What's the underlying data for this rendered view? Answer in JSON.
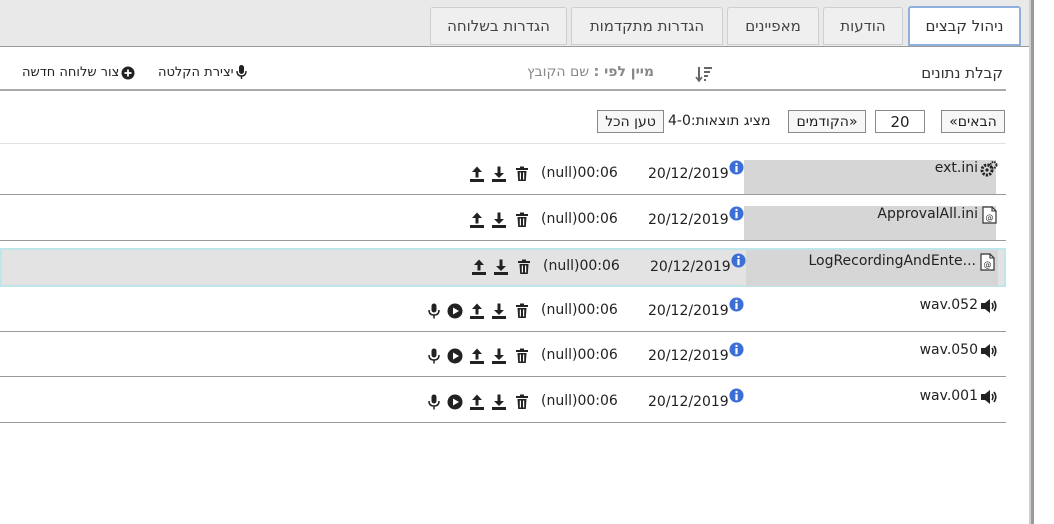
{
  "tabs": [
    {
      "label": "ניהול קבצים",
      "active": true
    },
    {
      "label": "הודעות",
      "active": false
    },
    {
      "label": "מאפיינים",
      "active": false
    },
    {
      "label": "הגדרות מתקדמות",
      "active": false
    },
    {
      "label": "הגדרות בשלוחה",
      "active": false
    }
  ],
  "toolbar": {
    "title": "קבלת נתונים",
    "sort_prefix": "מיין לפי :",
    "sort_value": " שם הקובץ",
    "record_label": "יצירת הקלטה",
    "new_ext_label": "צור שלוחה חדשה"
  },
  "pagination": {
    "next_label": "«הבאים",
    "page_size": "20",
    "prev_label": "הקודמים»",
    "showing_text": "מציג תוצאות:4-0",
    "load_all_label": "טען הכל"
  },
  "files": [
    {
      "name": "ext.ini",
      "icon": "gears-icon",
      "date": "20/12/2019",
      "duration": "(null)00:06",
      "audio": false,
      "highlighted": true,
      "selected": false
    },
    {
      "name": "ApprovalAll.ini",
      "icon": "ini-file-icon",
      "date": "20/12/2019",
      "duration": "(null)00:06",
      "audio": false,
      "highlighted": true,
      "selected": false
    },
    {
      "name": "LogRecordingAndEnte...",
      "icon": "ini-file-icon",
      "date": "20/12/2019",
      "duration": "(null)00:06",
      "audio": false,
      "highlighted": true,
      "selected": true
    },
    {
      "name": "wav.052",
      "icon": "speaker-icon",
      "date": "20/12/2019",
      "duration": "(null)00:06",
      "audio": true,
      "highlighted": false,
      "selected": false
    },
    {
      "name": "wav.050",
      "icon": "speaker-icon",
      "date": "20/12/2019",
      "duration": "(null)00:06",
      "audio": true,
      "highlighted": false,
      "selected": false
    },
    {
      "name": "wav.001",
      "icon": "speaker-icon",
      "date": "20/12/2019",
      "duration": "(null)00:06",
      "audio": true,
      "highlighted": false,
      "selected": false
    }
  ],
  "colors": {
    "tab_active_border": "#8fb0dc",
    "info_icon": "#3b6fd6",
    "selected_row_border": "#bfe6ea",
    "name_highlight": "#d6d6d6"
  }
}
